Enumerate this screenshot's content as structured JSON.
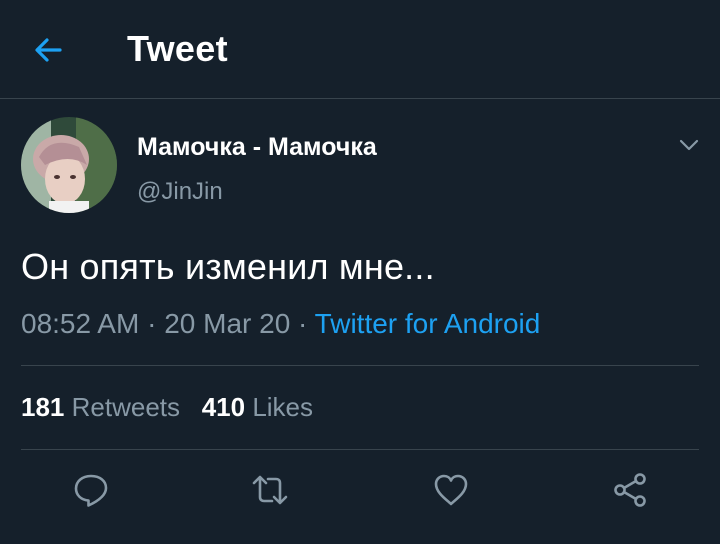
{
  "header": {
    "title": "Tweet",
    "back_icon": "arrow-left-icon"
  },
  "tweet": {
    "display_name": "Мамочка - Мамочка",
    "handle": "@JinJin",
    "text": "Он опять изменил мне...",
    "time": "08:52 AM",
    "separator": " · ",
    "date": "20 Mar 20",
    "source": "Twitter for Android"
  },
  "stats": {
    "retweets_count": "181",
    "retweets_label": "Retweets",
    "likes_count": "410",
    "likes_label": "Likes"
  },
  "actions": {
    "reply_icon": "reply-icon",
    "retweet_icon": "retweet-icon",
    "like_icon": "heart-icon",
    "share_icon": "share-icon"
  },
  "colors": {
    "background": "#15202b",
    "accent": "#1da1f2",
    "secondary_text": "#8899a6",
    "divider": "#38444d"
  }
}
